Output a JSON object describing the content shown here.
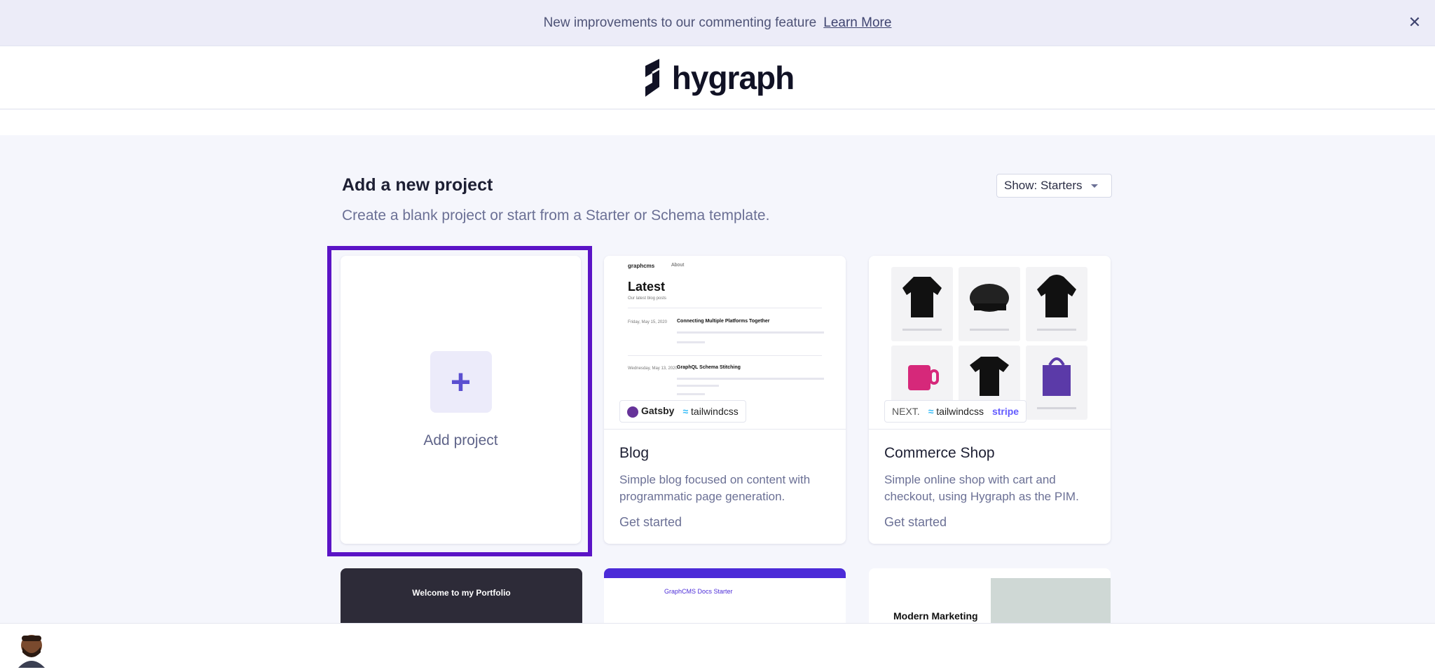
{
  "banner": {
    "message": "New improvements to our commenting feature",
    "link": "Learn More"
  },
  "header": {
    "brand": "hygraph"
  },
  "main": {
    "title": "Add a new project",
    "subtitle": "Create a blank project or start from a Starter or Schema template.",
    "filter": {
      "label": "Show: Starters"
    }
  },
  "add_card": {
    "label": "Add project",
    "icon": "plus-icon"
  },
  "cards": [
    {
      "title": "Blog",
      "description": "Simple blog focused on content with programmatic page generation.",
      "cta": "Get started",
      "tech": [
        "Gatsby",
        "tailwindcss"
      ],
      "preview": {
        "brand": "graphcms",
        "nav": "About",
        "heading": "Latest",
        "subheading": "Our latest blog posts",
        "posts": [
          {
            "date": "Friday, May 15, 2020",
            "title": "Connecting Multiple Platforms Together"
          },
          {
            "date": "Wednesday, May 13, 2020",
            "title": "GraphQL Schema Stitching"
          }
        ]
      }
    },
    {
      "title": "Commerce Shop",
      "description": "Simple online shop with cart and checkout, using Hygraph as the PIM.",
      "cta": "Get started",
      "tech": [
        "NEXT.",
        "tailwindcss",
        "stripe"
      ]
    }
  ],
  "partial_cards": [
    {
      "text": "Welcome to my Portfolio"
    },
    {
      "text": "GraphCMS Docs Starter"
    },
    {
      "text": "Modern Marketing"
    }
  ],
  "colors": {
    "accent": "#5b14c6",
    "banner_bg": "#ececf8",
    "page_bg": "#f5f6fc"
  }
}
